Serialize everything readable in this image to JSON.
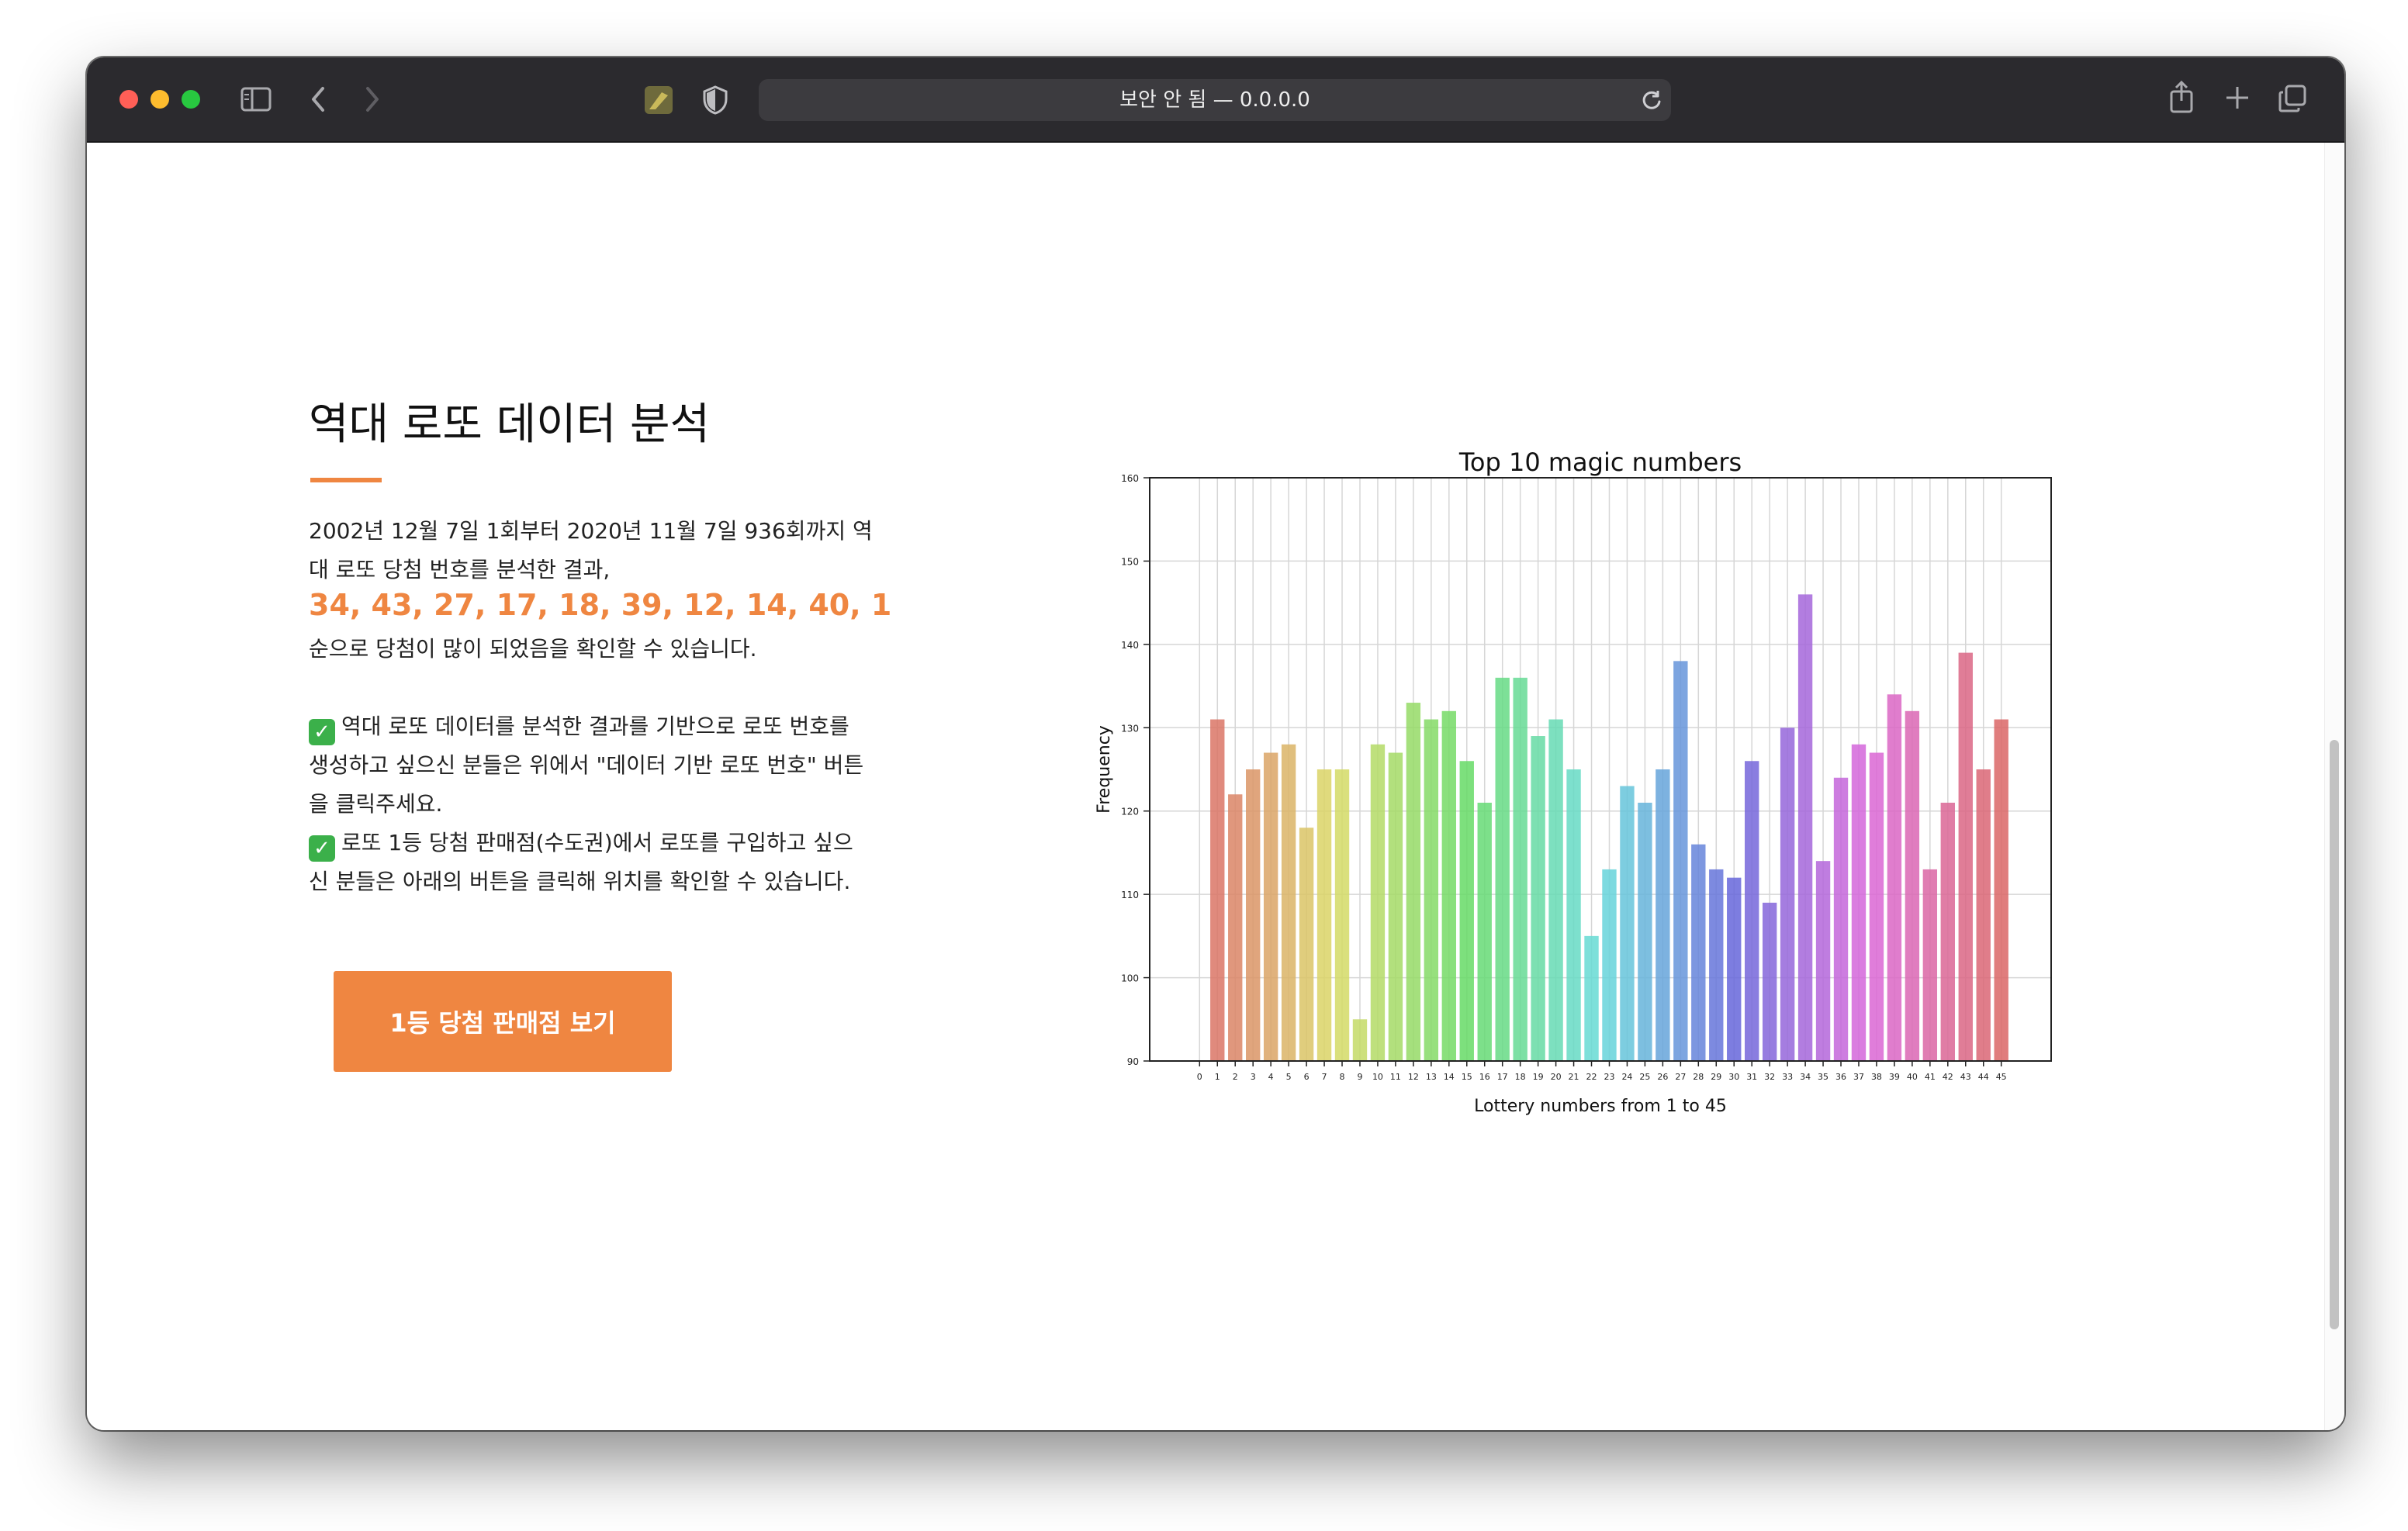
{
  "browser": {
    "url_text": "보안 안 됨 — 0.0.0.0"
  },
  "page": {
    "heading": "역대 로또 데이터 분석",
    "intro_line1": "2002년 12월 7일 1회부터 2020년 11월 7일 936회까지 역",
    "intro_line2": "대 로또 당첨 번호를 분석한 결과,",
    "top_numbers": "34, 43, 27, 17, 18, 39, 12, 14, 40, 1",
    "conclusion": "순으로 당첨이 많이 되었음을 확인할 수 있습니다.",
    "check_glyph": "✓",
    "note1_line1": "역대 로또 데이터를 분석한 결과를 기반으로 로또 번호를",
    "note1_line2": "생성하고 싶으신 분들은 위에서 \"데이터 기반 로또 번호\" 버튼",
    "note1_line3": "을 클릭주세요.",
    "note2_line1": "로또 1등 당첨 판매점(수도권)에서 로또를 구입하고 싶으",
    "note2_line2": "신 분들은 아래의 버튼을 클릭해 위치를 확인할 수 있습니다.",
    "button_label": "1등 당첨 판매점 보기"
  },
  "colors": {
    "accent": "#ef8641"
  },
  "chart_data": {
    "type": "bar",
    "title": "Top 10 magic numbers",
    "xlabel": "Lottery numbers from 1 to 45",
    "ylabel": "Frequency",
    "ylim": [
      90,
      160
    ],
    "yticks": [
      90,
      100,
      110,
      120,
      130,
      140,
      150,
      160
    ],
    "xticks": [
      "0",
      "1",
      "2",
      "3",
      "4",
      "5",
      "6",
      "7",
      "8",
      "9",
      "10",
      "11",
      "12",
      "13",
      "14",
      "15",
      "16",
      "17",
      "18",
      "19",
      "20",
      "21",
      "22",
      "23",
      "24",
      "25",
      "26",
      "27",
      "28",
      "29",
      "30",
      "31",
      "32",
      "33",
      "34",
      "35",
      "36",
      "37",
      "38",
      "39",
      "40",
      "41",
      "42",
      "43",
      "44",
      "45"
    ],
    "grid": true,
    "categories": [
      1,
      2,
      3,
      4,
      5,
      6,
      7,
      8,
      9,
      10,
      11,
      12,
      13,
      14,
      15,
      16,
      17,
      18,
      19,
      20,
      21,
      22,
      23,
      24,
      25,
      26,
      27,
      28,
      29,
      30,
      31,
      32,
      33,
      34,
      35,
      36,
      37,
      38,
      39,
      40,
      41,
      42,
      43,
      44,
      45
    ],
    "values": [
      131,
      122,
      125,
      127,
      128,
      118,
      125,
      125,
      95,
      128,
      127,
      133,
      131,
      132,
      126,
      121,
      136,
      136,
      129,
      131,
      125,
      105,
      113,
      123,
      121,
      125,
      138,
      116,
      113,
      112,
      126,
      109,
      130,
      146,
      114,
      124,
      128,
      127,
      134,
      132,
      113,
      121,
      139,
      125,
      131
    ]
  }
}
